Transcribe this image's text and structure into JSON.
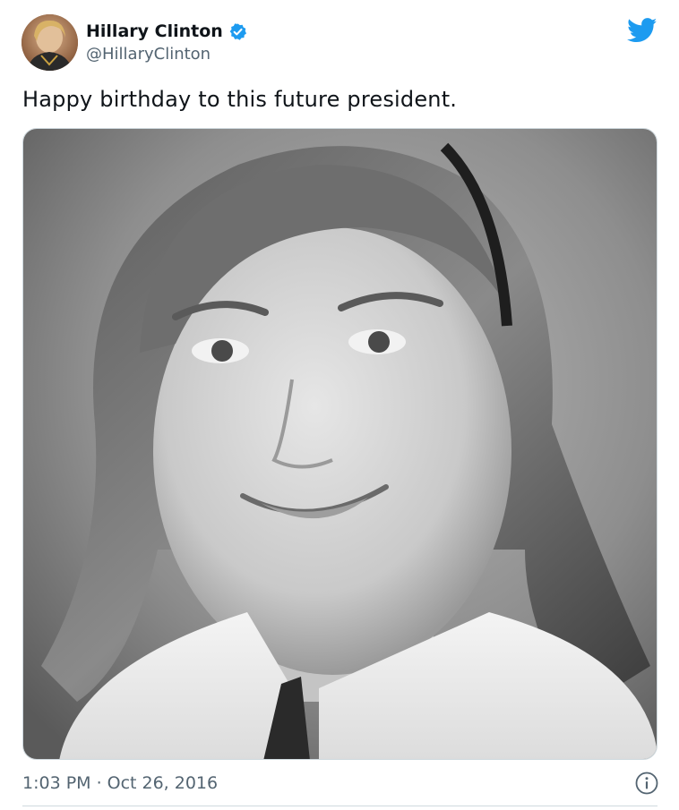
{
  "tweet": {
    "author": {
      "display_name": "Hillary Clinton",
      "handle": "@HillaryClinton",
      "verified": true,
      "avatar_icon": "profile-photo"
    },
    "text": "Happy birthday to this future president.",
    "media": {
      "type": "photo",
      "style": "black-and-white portrait"
    },
    "time": "1:03 PM",
    "separator": "·",
    "date": "Oct 26, 2016"
  },
  "icons": {
    "brand": "twitter-bird-icon",
    "verified": "verified-badge-icon",
    "info": "info-icon"
  },
  "colors": {
    "twitter_blue": "#1d9bf0",
    "text_primary": "#0f1419",
    "text_secondary": "#536471",
    "border": "#cfd9de"
  }
}
